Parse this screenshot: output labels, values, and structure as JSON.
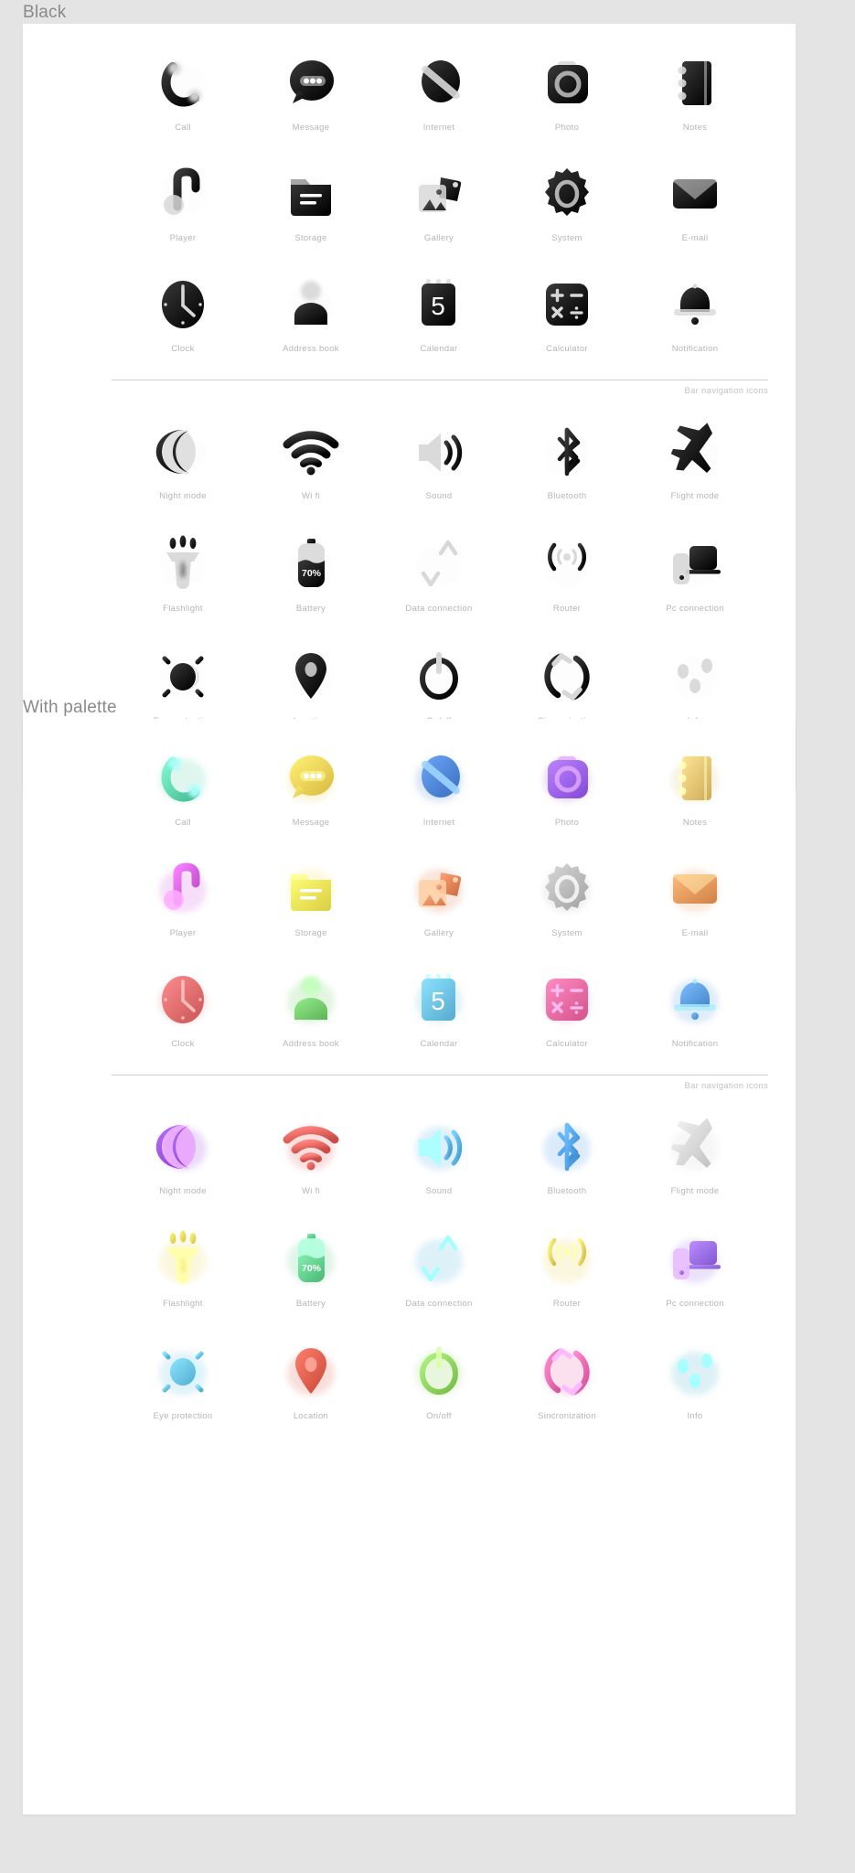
{
  "sections": [
    {
      "id": "black",
      "title": "Black",
      "divider_label": "Bar navigation icons",
      "app_rows": [
        [
          {
            "label": "Call",
            "icon": "call-icon",
            "color": "#000000"
          },
          {
            "label": "Message",
            "icon": "message-icon",
            "color": "#000000"
          },
          {
            "label": "Internet",
            "icon": "internet-icon",
            "color": "#000000"
          },
          {
            "label": "Photo",
            "icon": "photo-icon",
            "color": "#000000"
          },
          {
            "label": "Notes",
            "icon": "notes-icon",
            "color": "#000000"
          }
        ],
        [
          {
            "label": "Player",
            "icon": "player-icon",
            "color": "#000000"
          },
          {
            "label": "Storage",
            "icon": "storage-icon",
            "color": "#000000"
          },
          {
            "label": "Gallery",
            "icon": "gallery-icon",
            "color": "#000000"
          },
          {
            "label": "System",
            "icon": "system-icon",
            "color": "#000000"
          },
          {
            "label": "E-mail",
            "icon": "email-icon",
            "color": "#000000"
          }
        ],
        [
          {
            "label": "Clock",
            "icon": "clock-icon",
            "color": "#000000"
          },
          {
            "label": "Address book",
            "icon": "address-book-icon",
            "color": "#000000"
          },
          {
            "label": "Calendar",
            "icon": "calendar-icon",
            "color": "#000000",
            "value": "5"
          },
          {
            "label": "Calculator",
            "icon": "calculator-icon",
            "color": "#000000"
          },
          {
            "label": "Notification",
            "icon": "notification-icon",
            "color": "#000000"
          }
        ]
      ],
      "bar_rows": [
        [
          {
            "label": "Night mode",
            "icon": "night-mode-icon",
            "color": "#111111"
          },
          {
            "label": "Wi fi",
            "icon": "wifi-icon",
            "color": "#000000"
          },
          {
            "label": "Sound",
            "icon": "sound-icon",
            "color": "#000000"
          },
          {
            "label": "Bluetooth",
            "icon": "bluetooth-icon",
            "color": "#000000"
          },
          {
            "label": "Flight mode",
            "icon": "flight-mode-icon",
            "color": "#000000"
          }
        ],
        [
          {
            "label": "Flashlight",
            "icon": "flashlight-icon",
            "color": "#000000"
          },
          {
            "label": "Battery",
            "icon": "battery-icon",
            "color": "#000000",
            "value": "70%"
          },
          {
            "label": "Data connection",
            "icon": "data-connection-icon",
            "color": "#000000"
          },
          {
            "label": "Router",
            "icon": "router-icon",
            "color": "#000000"
          },
          {
            "label": "Pc connection",
            "icon": "pc-connection-icon",
            "color": "#000000"
          }
        ],
        [
          {
            "label": "Eye protection",
            "icon": "eye-protection-icon",
            "color": "#000000"
          },
          {
            "label": "Location",
            "icon": "location-icon",
            "color": "#000000"
          },
          {
            "label": "On/off",
            "icon": "on-off-icon",
            "color": "#000000"
          },
          {
            "label": "Sincronization",
            "icon": "sincronization-icon",
            "color": "#000000"
          },
          {
            "label": "Info",
            "icon": "info-icon",
            "color": "#000000"
          }
        ]
      ]
    },
    {
      "id": "palette",
      "title": "With palette",
      "divider_label": "Bar navigation icons",
      "app_rows": [
        [
          {
            "label": "Call",
            "icon": "call-icon",
            "color": "#5fd6ae"
          },
          {
            "label": "Message",
            "icon": "message-icon",
            "color": "#f0d257"
          },
          {
            "label": "Internet",
            "icon": "internet-icon",
            "color": "#4f86d8"
          },
          {
            "label": "Photo",
            "icon": "photo-icon",
            "color": "#9b62ef"
          },
          {
            "label": "Notes",
            "icon": "notes-icon",
            "color": "#e4c473"
          }
        ],
        [
          {
            "label": "Player",
            "icon": "player-icon",
            "color": "#d55fe0"
          },
          {
            "label": "Storage",
            "icon": "storage-icon",
            "color": "#f2e65a"
          },
          {
            "label": "Gallery",
            "icon": "gallery-icon",
            "color": "#e08256"
          },
          {
            "label": "System",
            "icon": "system-icon",
            "color": "#b9b9b9"
          },
          {
            "label": "E-mail",
            "icon": "email-icon",
            "color": "#e89a5d"
          }
        ],
        [
          {
            "label": "Clock",
            "icon": "clock-icon",
            "color": "#df6d6d"
          },
          {
            "label": "Address book",
            "icon": "address-book-icon",
            "color": "#76cd6e"
          },
          {
            "label": "Calendar",
            "icon": "calendar-icon",
            "color": "#6ec2e6",
            "value": "5"
          },
          {
            "label": "Calculator",
            "icon": "calculator-icon",
            "color": "#ec6ba3"
          },
          {
            "label": "Notification",
            "icon": "notification-icon",
            "color": "#5d9fe0"
          }
        ]
      ],
      "bar_rows": [
        [
          {
            "label": "Night mode",
            "icon": "night-mode-icon",
            "color": "#9b4fe0"
          },
          {
            "label": "Wi fi",
            "icon": "wifi-icon",
            "color": "#e0625c"
          },
          {
            "label": "Sound",
            "icon": "sound-icon",
            "color": "#5cb3e8"
          },
          {
            "label": "Bluetooth",
            "icon": "bluetooth-icon",
            "color": "#4f9fe8"
          },
          {
            "label": "Flight mode",
            "icon": "flight-mode-icon",
            "color": "#d6d6d6"
          }
        ],
        [
          {
            "label": "Flashlight",
            "icon": "flashlight-icon",
            "color": "#ecd95e"
          },
          {
            "label": "Battery",
            "icon": "battery-icon",
            "color": "#62cf8e",
            "value": "70%"
          },
          {
            "label": "Data connection",
            "icon": "data-connection-icon",
            "color": "#56bde0"
          },
          {
            "label": "Router",
            "icon": "router-icon",
            "color": "#ecd65e"
          },
          {
            "label": "Pc connection",
            "icon": "pc-connection-icon",
            "color": "#9b6fe8"
          }
        ],
        [
          {
            "label": "Eye protection",
            "icon": "eye-protection-icon",
            "color": "#6cc5e8"
          },
          {
            "label": "Location",
            "icon": "location-icon",
            "color": "#e05f4f"
          },
          {
            "label": "On/off",
            "icon": "on-off-icon",
            "color": "#8ed45e"
          },
          {
            "label": "Sincronization",
            "icon": "sincronization-icon",
            "color": "#ec6bb0"
          },
          {
            "label": "Info",
            "icon": "info-icon",
            "color": "#56b8cf"
          }
        ]
      ]
    }
  ]
}
